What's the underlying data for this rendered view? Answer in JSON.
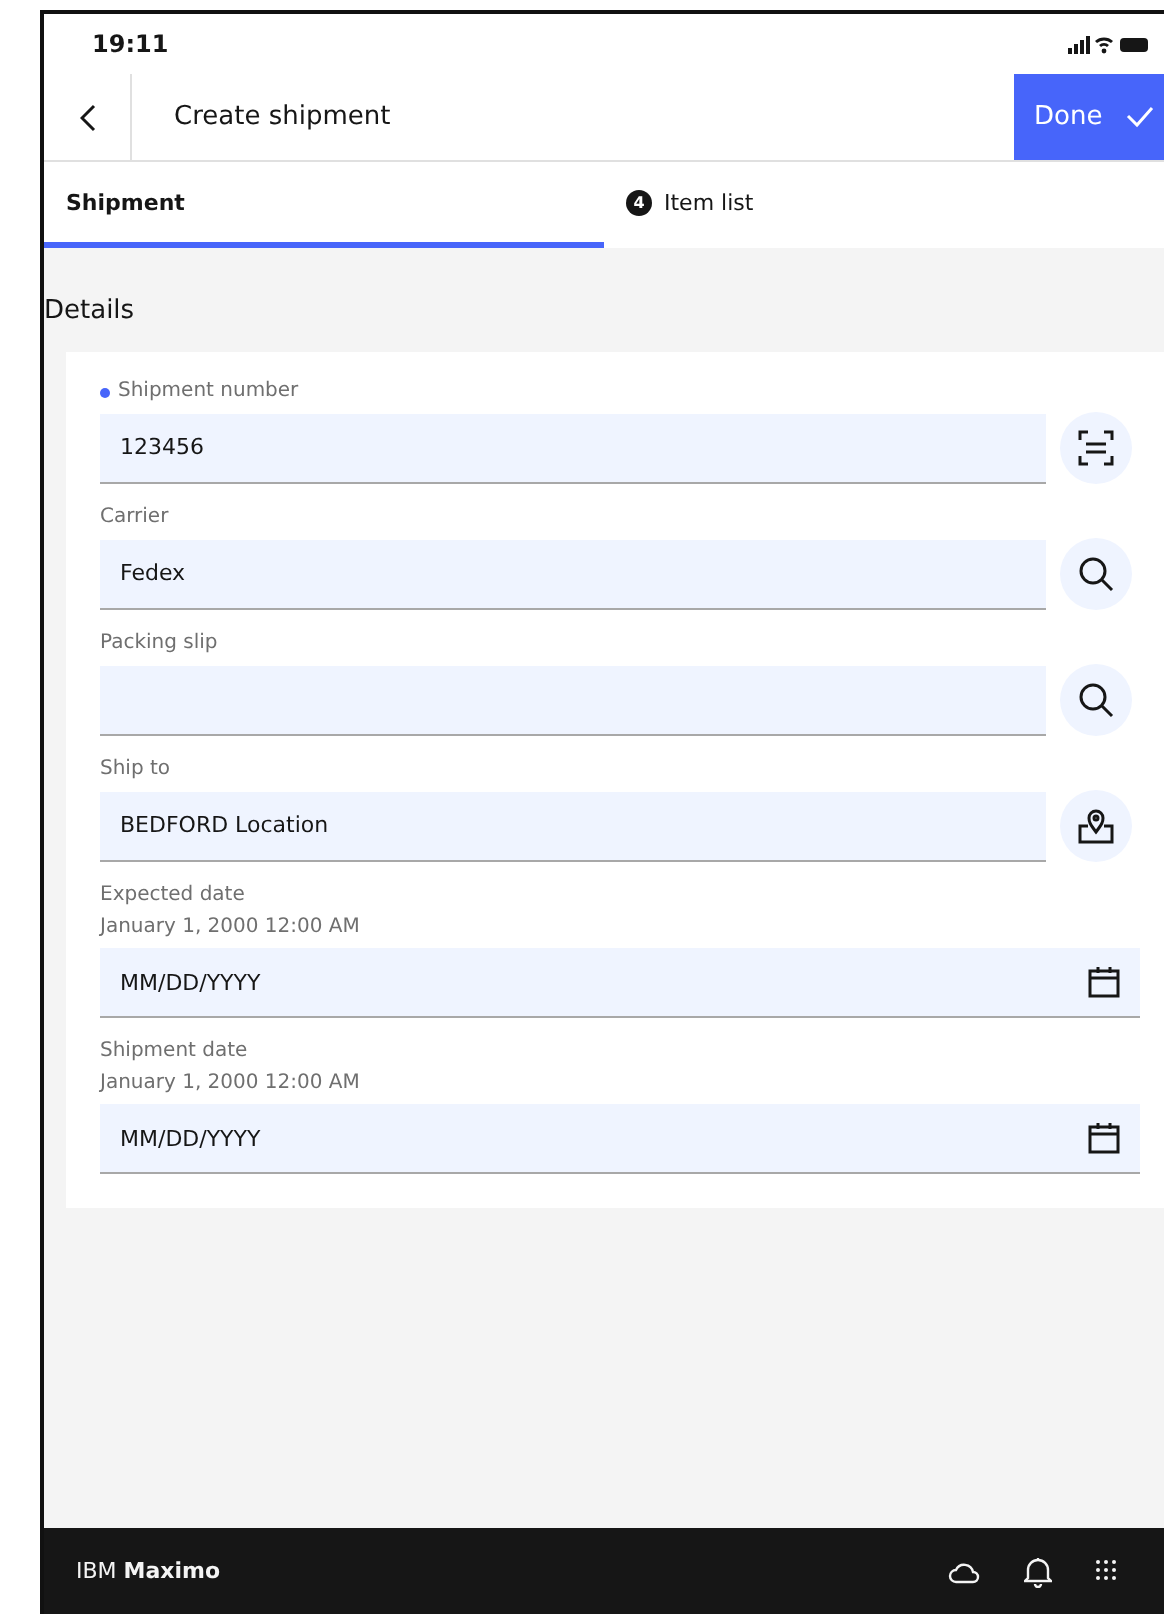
{
  "status_bar": {
    "time": "19:11"
  },
  "header": {
    "title": "Create shipment",
    "done_button": "Done"
  },
  "tabs": [
    {
      "label": "Shipment",
      "selected": true
    },
    {
      "label": "Item list",
      "badge": "4",
      "selected": false
    }
  ],
  "section_title": "Details",
  "fields": [
    {
      "kind": "scan",
      "label": "Shipment number",
      "required": true,
      "value": "123456"
    },
    {
      "kind": "search",
      "label": "Carrier",
      "required": false,
      "value": "Fedex"
    },
    {
      "kind": "search",
      "label": "Packing slip",
      "required": false
    },
    {
      "kind": "location",
      "label": "Ship to",
      "required": false,
      "value": "BEDFORD Location"
    },
    {
      "kind": "date",
      "label": "Expected date",
      "current": "January 1, 2000 12:00 AM",
      "placeholder": "MM/DD/YYYY"
    },
    {
      "kind": "date",
      "label": "Shipment date",
      "current": "January 1, 2000 12:00 AM",
      "placeholder": "MM/DD/YYYY"
    }
  ],
  "footer": {
    "brand": "IBM **Maximo**"
  }
}
